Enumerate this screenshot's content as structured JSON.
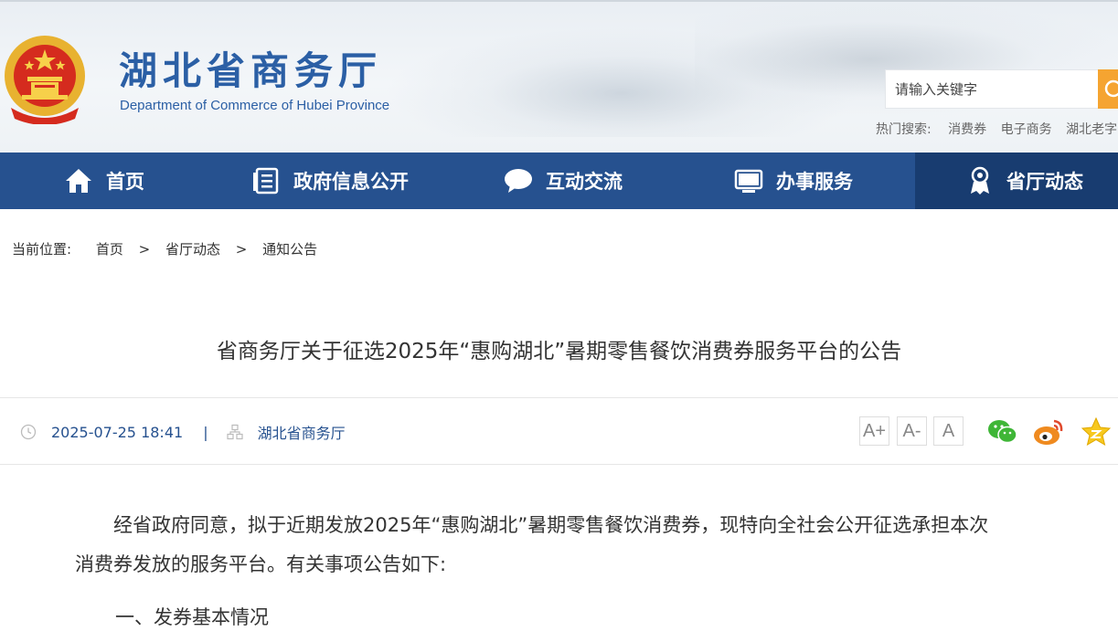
{
  "header": {
    "site_title": "湖北省商务厅",
    "site_subtitle": "Department of Commerce of Hubei Province",
    "search_placeholder": "请输入关键字",
    "hot_label": "热门搜索:",
    "hot_keywords": [
      "消费券",
      "电子商务",
      "湖北老字"
    ]
  },
  "nav": {
    "items": [
      {
        "label": "首页",
        "icon": "home-icon"
      },
      {
        "label": "政府信息公开",
        "icon": "document-list-icon"
      },
      {
        "label": "互动交流",
        "icon": "chat-bubble-icon"
      },
      {
        "label": "办事服务",
        "icon": "monitor-icon"
      },
      {
        "label": "省厅动态",
        "icon": "badge-person-icon",
        "active": true
      }
    ]
  },
  "breadcrumb": {
    "label": "当前位置:",
    "items": [
      "首页",
      "省厅动态",
      "通知公告"
    ],
    "separator": ">"
  },
  "article": {
    "title": "省商务厅关于征选2025年“惠购湖北”暑期零售餐饮消费券服务平台的公告",
    "date": "2025-07-25 18:41",
    "meta_separator": "|",
    "source": "湖北省商务厅",
    "font_sizes": [
      "A+",
      "A-",
      "A"
    ],
    "share": [
      "wechat-icon",
      "weibo-icon",
      "favorite-star-icon"
    ],
    "paragraph_line1": "经省政府同意，拟于近期发放2025年“惠购湖北”暑期零售餐饮消费券，现特向全社会公开征选承担本次",
    "paragraph_line2": "消费券发放的服务平台。有关事项公告如下:",
    "section_1": "一、发券基本情况"
  },
  "colors": {
    "nav_bg": "#26518f",
    "nav_active_bg": "#183c70",
    "brand_blue": "#2b5fa5",
    "search_button": "#f5a431"
  }
}
